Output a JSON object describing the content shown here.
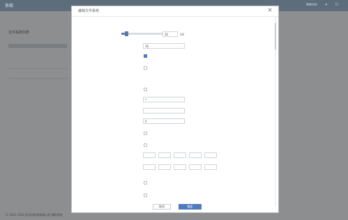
{
  "topbar": {
    "left": "系统",
    "right_items": [
      "Admin",
      "▾",
      "☐"
    ]
  },
  "page": {
    "section_title": "文件系统列表",
    "section_tab": "",
    "table_header": "",
    "footer": "© 2021-2022 北京云科技有限公司 版权所有"
  },
  "modal": {
    "title": "编辑文件系统",
    "subtitle": "",
    "fields": {
      "size": {
        "label": "",
        "value": "32",
        "unit": "GB"
      },
      "id_input_label": "",
      "id_input_value": "16",
      "checkbox_1_label": "",
      "checkbox_2_label": "",
      "section_left": "",
      "check_3_label": "",
      "readwrite_label": "",
      "readwrite_value": "*",
      "rw_hint": "",
      "rdonly_label": "",
      "rdonly_value": "",
      "rdonly_hint": "",
      "users_label": "",
      "users_value": "5",
      "users_hint": "",
      "check_4_label": "",
      "check_5_label": "",
      "time1_label": "",
      "time2_label": "",
      "time_hint": "",
      "check_6_label": "",
      "check_7_label": ""
    },
    "buttons": {
      "cancel": "取消",
      "save": "确定"
    }
  }
}
